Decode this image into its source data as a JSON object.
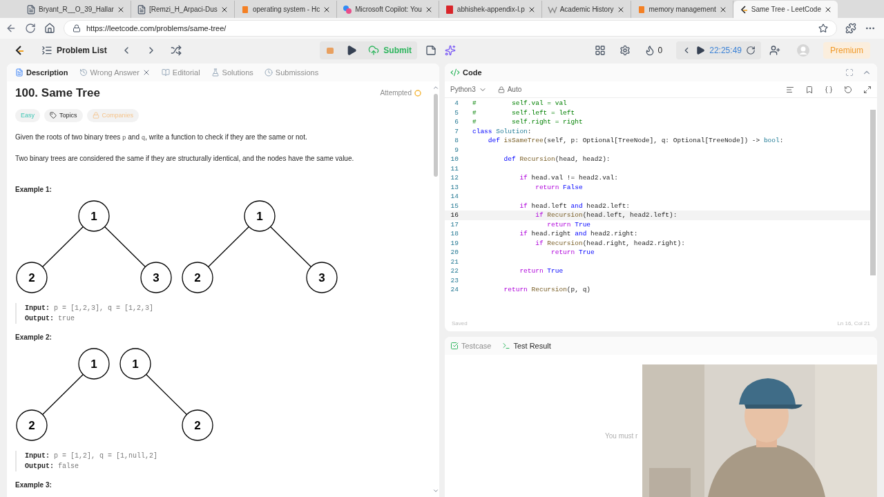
{
  "browser_tabs": [
    {
      "title": "Bryant_R__O_39_Hallar",
      "selected": false
    },
    {
      "title": "[Remzi_H_Arpaci-Dus",
      "selected": false
    },
    {
      "title": "operating system - Hc",
      "selected": false
    },
    {
      "title": "Microsoft Copilot: You",
      "selected": false
    },
    {
      "title": "abhishek-appendix-l.p",
      "selected": false
    },
    {
      "title": "Academic History",
      "selected": false
    },
    {
      "title": "memory management",
      "selected": false
    },
    {
      "title": "Same Tree - LeetCode",
      "selected": true
    }
  ],
  "address": "https://leetcode.com/problems/same-tree/",
  "nav": {
    "problem_list": "Problem List",
    "submit": "Submit",
    "streak": "0",
    "timer": "22:25:49",
    "premium": "Premium"
  },
  "left_tabs": [
    {
      "label": "Description",
      "selected": true,
      "closable": false
    },
    {
      "label": "Wrong Answer",
      "selected": false,
      "closable": true
    },
    {
      "label": "Editorial",
      "selected": false,
      "closable": false
    },
    {
      "label": "Solutions",
      "selected": false,
      "closable": false
    },
    {
      "label": "Submissions",
      "selected": false,
      "closable": false
    }
  ],
  "problem": {
    "title": "100. Same Tree",
    "status": "Attempted",
    "difficulty": "Easy",
    "topics": "Topics",
    "companies": "Companies",
    "paragraphs": [
      [
        {
          "text": "Given the roots of two binary trees "
        },
        {
          "text": "p",
          "code": true
        },
        {
          "text": " and "
        },
        {
          "text": "q",
          "code": true
        },
        {
          "text": ", write a function to check if they are the same or not."
        }
      ],
      [
        {
          "text": "Two binary trees are considered the same if they are structurally identical, and the nodes have the same value."
        }
      ]
    ],
    "examples": [
      {
        "heading": "Example 1:",
        "trees": [
          {
            "label": "1",
            "left": {
              "label": "2"
            },
            "right": {
              "label": "3"
            }
          },
          {
            "label": "1",
            "left": {
              "label": "2"
            },
            "right": {
              "label": "3"
            }
          }
        ],
        "input_label": "Input:",
        "input": "p = [1,2,3], q = [1,2,3]",
        "output_label": "Output:",
        "output": "true"
      },
      {
        "heading": "Example 2:",
        "trees": [
          {
            "label": "1",
            "left": {
              "label": "2"
            }
          },
          {
            "label": "1",
            "right": {
              "label": "2"
            }
          }
        ],
        "input_label": "Input:",
        "input": "p = [1,2], q = [1,null,2]",
        "output_label": "Output:",
        "output": "false"
      }
    ],
    "next_heading": "Example 3:"
  },
  "code_panel": {
    "title": "Code",
    "language": "Python3",
    "mode": "Auto",
    "saved": "Saved",
    "position": "Ln 16, Col 21",
    "lines": [
      {
        "number": "4",
        "current": false,
        "segments": [
          {
            "text": "#         self.val = val",
            "kind": "comment"
          }
        ]
      },
      {
        "number": "5",
        "current": false,
        "segments": [
          {
            "text": "#         self.left = left",
            "kind": "comment"
          }
        ]
      },
      {
        "number": "6",
        "current": false,
        "segments": [
          {
            "text": "#         self.right = right",
            "kind": "comment"
          }
        ]
      },
      {
        "number": "7",
        "current": false,
        "segments": [
          {
            "text": "class",
            "kind": "kw"
          },
          {
            "text": " Solution",
            "kind": "cls"
          },
          {
            "text": ":",
            "kind": "plain"
          }
        ]
      },
      {
        "number": "8",
        "current": false,
        "segments": [
          {
            "text": "    def",
            "kind": "kw"
          },
          {
            "text": " isSameTree",
            "kind": "fn"
          },
          {
            "text": "(self, p: Optional[TreeNode], q: Optional[TreeNode]) ->",
            "kind": "plain"
          },
          {
            "text": " bool",
            "kind": "cls"
          },
          {
            "text": ":",
            "kind": "plain"
          }
        ]
      },
      {
        "number": "9",
        "current": false
      },
      {
        "number": "10",
        "current": false,
        "segments": [
          {
            "text": "        def",
            "kind": "kw"
          },
          {
            "text": " Recursion",
            "kind": "fn"
          },
          {
            "text": "(head, head2):",
            "kind": "plain"
          }
        ]
      },
      {
        "number": "11",
        "current": false
      },
      {
        "number": "12",
        "current": false,
        "segments": [
          {
            "text": "            if",
            "kind": "ctrl"
          },
          {
            "text": " head.val != head2.val:",
            "kind": "plain"
          }
        ]
      },
      {
        "number": "13",
        "current": false,
        "segments": [
          {
            "text": "                return",
            "kind": "ctrl"
          },
          {
            "text": " False",
            "kind": "const"
          }
        ]
      },
      {
        "number": "14",
        "current": false
      },
      {
        "number": "15",
        "current": false,
        "segments": [
          {
            "text": "            if",
            "kind": "ctrl"
          },
          {
            "text": " head.left",
            "kind": "plain"
          },
          {
            "text": " and",
            "kind": "kw"
          },
          {
            "text": " head2.left:",
            "kind": "plain"
          }
        ]
      },
      {
        "number": "16",
        "current": true,
        "segments": [
          {
            "text": "                if",
            "kind": "ctrl"
          },
          {
            "text": " Recursion",
            "kind": "fn"
          },
          {
            "text": "(head.left, head2.left):",
            "kind": "plain"
          }
        ]
      },
      {
        "number": "17",
        "current": false,
        "segments": [
          {
            "text": "                   return",
            "kind": "ctrl"
          },
          {
            "text": " True",
            "kind": "const"
          }
        ]
      },
      {
        "number": "18",
        "current": false,
        "segments": [
          {
            "text": "            if",
            "kind": "ctrl"
          },
          {
            "text": " head.right",
            "kind": "plain"
          },
          {
            "text": " and",
            "kind": "kw"
          },
          {
            "text": " head2.right:",
            "kind": "plain"
          }
        ]
      },
      {
        "number": "19",
        "current": false,
        "segments": [
          {
            "text": "                if",
            "kind": "ctrl"
          },
          {
            "text": " Recursion",
            "kind": "fn"
          },
          {
            "text": "(head.right, head2.right):",
            "kind": "plain"
          }
        ]
      },
      {
        "number": "20",
        "current": false,
        "segments": [
          {
            "text": "                    return",
            "kind": "ctrl"
          },
          {
            "text": " True",
            "kind": "const"
          }
        ]
      },
      {
        "number": "21",
        "current": false
      },
      {
        "number": "22",
        "current": false,
        "segments": [
          {
            "text": "            return",
            "kind": "ctrl"
          },
          {
            "text": " True",
            "kind": "const"
          }
        ]
      },
      {
        "number": "23",
        "current": false
      },
      {
        "number": "24",
        "current": false,
        "segments": [
          {
            "text": "        return",
            "kind": "ctrl"
          },
          {
            "text": " Recursion",
            "kind": "fn"
          },
          {
            "text": "(p, q)",
            "kind": "plain"
          }
        ]
      }
    ]
  },
  "result_tabs": [
    {
      "label": "Testcase",
      "selected": false
    },
    {
      "label": "Test Result",
      "selected": true
    }
  ],
  "result_hint": "You must r"
}
